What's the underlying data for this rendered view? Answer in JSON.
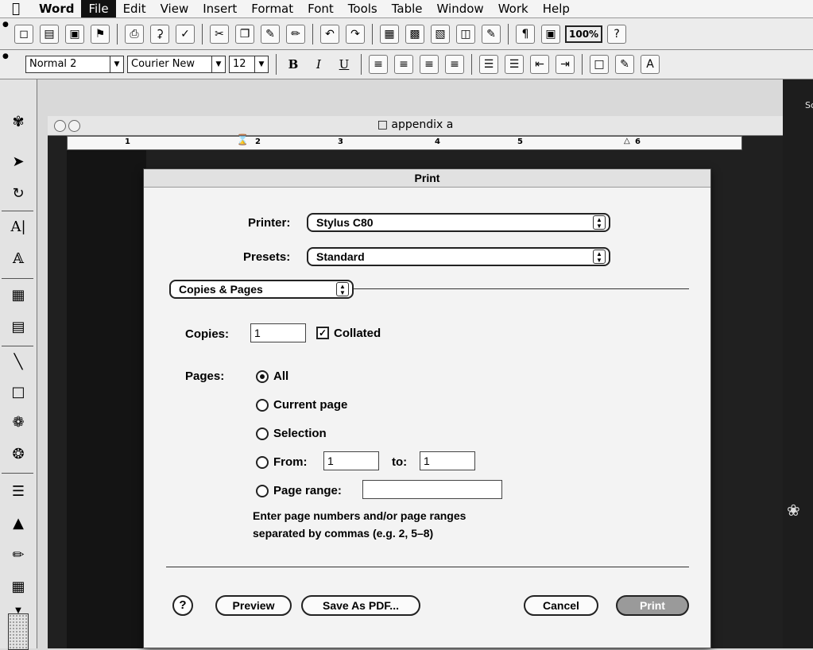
{
  "menubar": {
    "apple": "",
    "items": [
      "Word",
      "File",
      "Edit",
      "View",
      "Insert",
      "Format",
      "Font",
      "Tools",
      "Table",
      "Window",
      "Work",
      "Help"
    ],
    "active": "File"
  },
  "standard_toolbar": {
    "zoom": "100%"
  },
  "formatting_toolbar": {
    "style": "Normal 2",
    "font": "Courier New",
    "size": "12",
    "bold": "B",
    "italic": "I",
    "underline": "U"
  },
  "right_edge_text": "Sc",
  "document": {
    "title": "appendix a",
    "ruler_numbers": [
      "1",
      "2",
      "3",
      "4",
      "5",
      "6"
    ]
  },
  "print_dialog": {
    "title": "Print",
    "printer_label": "Printer:",
    "printer_value": "Stylus C80",
    "presets_label": "Presets:",
    "presets_value": "Standard",
    "panel_value": "Copies & Pages",
    "copies_label": "Copies:",
    "copies_value": "1",
    "collated_label": "Collated",
    "collated_checked": true,
    "pages_label": "Pages:",
    "options": {
      "all": "All",
      "current": "Current page",
      "selection": "Selection",
      "from": "From:",
      "to": "to:",
      "range": "Page range:"
    },
    "from_value": "1",
    "to_value": "1",
    "range_value": "",
    "hint_line1": "Enter page numbers and/or page ranges",
    "hint_line2": "separated by commas (e.g. 2, 5–8)",
    "help_label": "?",
    "preview_label": "Preview",
    "pdf_label": "Save As PDF...",
    "cancel_label": "Cancel",
    "print_label": "Print"
  }
}
